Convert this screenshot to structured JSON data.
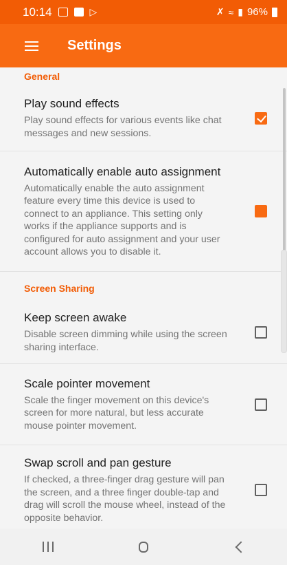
{
  "status_bar": {
    "time": "10:14",
    "left_icons": [
      "gallery-icon",
      "message-icon",
      "app-notification-icon"
    ],
    "right_icons": [
      "mute-icon",
      "wifi-icon",
      "signal-icon"
    ],
    "battery_text": "96%"
  },
  "app_bar": {
    "title": "Settings",
    "menu_icon": "hamburger-menu-icon",
    "color": "#f86a12"
  },
  "sections": [
    {
      "header": "General",
      "items": [
        {
          "title": "Play sound effects",
          "summary": "Play sound effects for various events like chat messages and new sessions.",
          "checked": true
        },
        {
          "title": "Automatically enable auto assignment",
          "summary": "Automatically enable the auto assignment feature every time this device is used to connect to an appliance. This setting only works if the appliance supports and is configured for auto assignment and your user account allows you to disable it.",
          "checked": "indeterminate"
        }
      ]
    },
    {
      "header": "Screen Sharing",
      "items": [
        {
          "title": "Keep screen awake",
          "summary": "Disable screen dimming while using the screen sharing interface.",
          "checked": false
        },
        {
          "title": "Scale pointer movement",
          "summary": "Scale the finger movement on this device's screen for more natural, but less accurate mouse pointer movement.",
          "checked": false
        },
        {
          "title": "Swap scroll and pan gesture",
          "summary": "If checked, a three-finger drag gesture will pan the screen, and a three finger double-tap and drag will scroll the mouse wheel, instead of the opposite behavior.",
          "checked": false
        }
      ]
    }
  ],
  "nav_bar": {
    "buttons": [
      "recent-apps-icon",
      "home-icon",
      "back-icon"
    ]
  }
}
